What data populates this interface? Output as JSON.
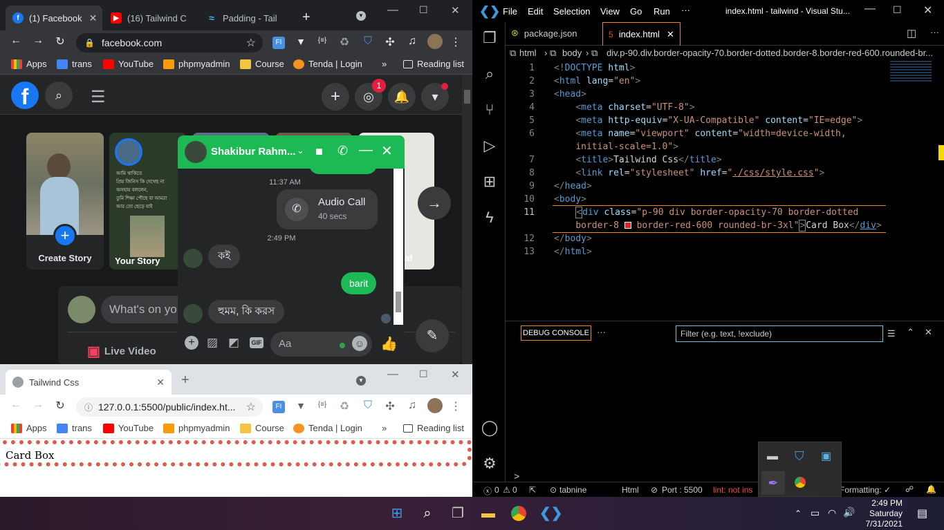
{
  "chrome_top": {
    "tabs": [
      {
        "label": "(1) Facebook",
        "active": true
      },
      {
        "label": "(16) Tailwind C"
      },
      {
        "label": "Padding - Tail"
      }
    ],
    "url": "facebook.com",
    "bookmarks": [
      "Apps",
      "trans",
      "YouTube",
      "phpmyadmin",
      "Course",
      "Tenda | Login"
    ],
    "reading_list": "Reading list",
    "ext_fi": "FI",
    "ext_code": "{≡}"
  },
  "facebook": {
    "messenger_badge": "1",
    "stories": [
      {
        "label": "Create Story"
      },
      {
        "label": "Your Story"
      },
      {
        "label": "raf"
      }
    ],
    "composer_placeholder": "What's on yo",
    "live_video": "Live Video",
    "story_text_lines": [
      "আমি থাকিতে",
      "প্রিয় জিনিস কি দেখেছ না",
      "অসহায় বললেন,",
      "তুমি শিক্ষা পৌছে বা আমরা",
      "আর তো ছেড়ে যাই"
    ]
  },
  "chat": {
    "name": "Shakibur Rahm...",
    "time1": "11:37 AM",
    "call_title": "Audio Call",
    "call_duration": "40 secs",
    "time2": "2:49 PM",
    "msg1": "কই",
    "msg2": "barit",
    "msg3": "হুমম, কি করস",
    "input_placeholder": "Aa",
    "gif": "GIF"
  },
  "chrome_bottom": {
    "tab": "Tailwind Css",
    "url": "127.0.0.1:5500/public/index.ht...",
    "bookmarks": [
      "Apps",
      "trans",
      "YouTube",
      "phpmyadmin",
      "Course",
      "Tenda | Login"
    ],
    "reading_list": "Reading list",
    "page_text": "Card Box"
  },
  "vscode": {
    "menu": [
      "File",
      "Edit",
      "Selection",
      "View",
      "Go",
      "Run",
      "···"
    ],
    "title": "index.html - tailwind - Visual Stu...",
    "tabs": [
      "package.json",
      "index.html"
    ],
    "breadcrumb": [
      "html",
      "body",
      "div.p-90.div.border-opacity-70.border-dotted.border-8.border-red-600.rounded-br..."
    ],
    "line_numbers": [
      "1",
      "2",
      "3",
      "4",
      "5",
      "6",
      "",
      "7",
      "8",
      "9",
      "10",
      "11",
      "",
      "12",
      "13"
    ],
    "panel_tab": "DEBUG CONSOLE",
    "panel_more": "···",
    "filter_placeholder": "Filter (e.g. text, !exclude)",
    "prompt": ">",
    "status": {
      "errors": "0",
      "warnings": "0",
      "tabnine": "tabnine",
      "lang": "Html",
      "port": "Port : 5500",
      "lint": "lint: not ins",
      "formatting": "Formatting: ✓"
    }
  },
  "taskbar": {
    "time": "2:49 PM",
    "day": "Saturday",
    "date": "7/31/2021"
  },
  "colors": {
    "fb_blue": "#1877f2",
    "chat_green": "#1db954",
    "vs_blue": "#569cd6",
    "card_red": "#dc2626"
  }
}
